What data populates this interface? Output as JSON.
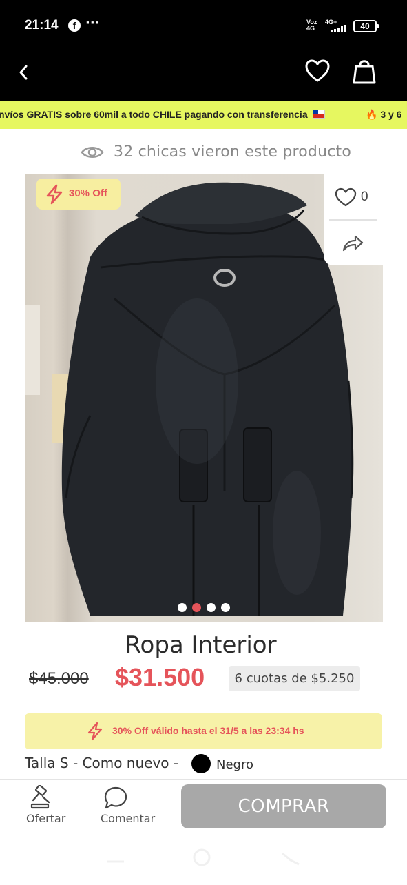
{
  "status_bar": {
    "time": "21:14",
    "facebook_glyph": "f",
    "more_glyph": "···",
    "network_top": "Voz",
    "network_bottom": "4G",
    "signal_label": "4G+",
    "battery": "40"
  },
  "top_nav": {
    "back_icon": "chevron-left-icon",
    "favorite_icon": "heart-icon",
    "cart_icon": "shopping-bag-icon"
  },
  "promo_banner": {
    "text": "nvíos GRATIS sobre 60mil a todo CHILE pagando con transferencia",
    "next_text": "🔥 3 y 6"
  },
  "views": {
    "text": "32 chicas vieron este producto"
  },
  "product": {
    "discount_badge": "30% Off",
    "likes": "0",
    "image_count": 4,
    "active_image": 2,
    "title": "Ropa Interior",
    "old_price": "$45.000",
    "price": "$31.500",
    "installments": "6 cuotas de $5.250",
    "offer_text": "30% Off válido hasta el 31/5 a las 23:34 hs",
    "details": "Talla S - Como nuevo -",
    "color_name": "Negro",
    "color_hex": "#000000"
  },
  "bottom_bar": {
    "offer_label": "Ofertar",
    "comment_label": "Comentar",
    "buy_label": "COMPRAR"
  },
  "colors": {
    "accent_red": "#e5545a",
    "promo_yellow": "#e6f760",
    "offer_yellow": "#f7f2a8",
    "buy_button": "#a8a8a8"
  }
}
